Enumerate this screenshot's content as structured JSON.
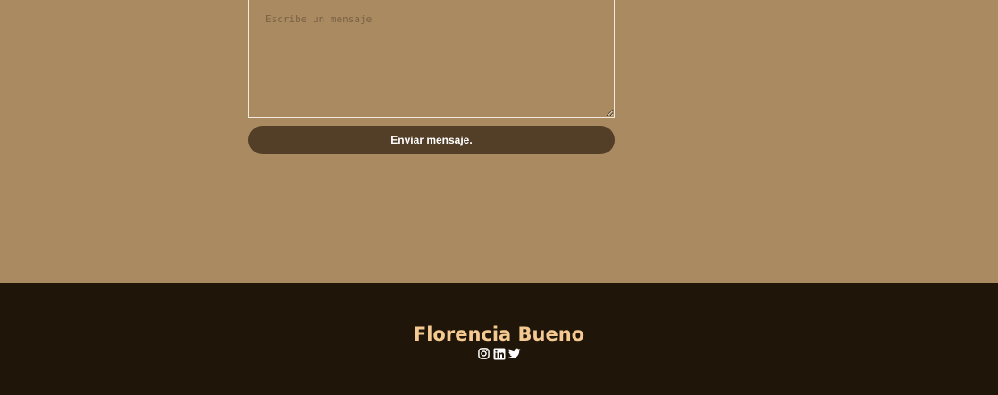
{
  "contact_form": {
    "message_placeholder": "Escribe un mensaje",
    "message_value": "",
    "send_label": "Enviar mensaje."
  },
  "footer": {
    "name": "Florencia Bueno",
    "social_icons": [
      "instagram-icon",
      "linkedin-icon",
      "twitter-icon"
    ]
  },
  "colors": {
    "section_bg": "#a98a61",
    "button_bg": "#533f27",
    "footer_bg": "#1f1508",
    "footer_name": "#f5c992"
  }
}
